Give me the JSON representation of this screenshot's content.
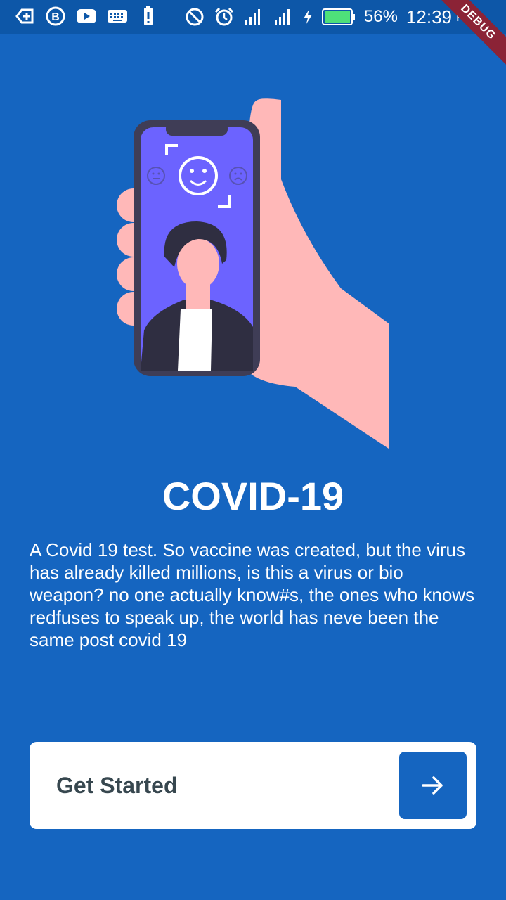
{
  "status_bar": {
    "battery_percent": "56%",
    "time": "12:39",
    "ampm": "PM",
    "left_icons": [
      "add-box-icon",
      "business-b-icon",
      "youtube-icon",
      "keyboard-icon",
      "battery-alert-icon"
    ],
    "right_icons": [
      "do-not-disturb-icon",
      "alarm-icon",
      "signal-icon",
      "signal-icon",
      "charging-icon",
      "battery-icon"
    ]
  },
  "debug_banner": "DEBUG",
  "illustration": {
    "icon": "face-scan-phone-illustration",
    "colors": {
      "skin": "#ffb8b8",
      "phone": "#3f3d56",
      "screen": "#6c63ff",
      "hair": "#2f2e41"
    }
  },
  "content": {
    "title": "COVID-19",
    "description": "A Covid 19 test. So vaccine was created, but the virus has already killed millions, is this a virus or bio weapon? no one actually know#s, the ones who knows redfuses to speak up, the world has neve been the same post covid 19"
  },
  "cta": {
    "label": "Get Started",
    "icon": "arrow-right-icon"
  },
  "colors": {
    "background": "#1565c0",
    "status_bar": "#0d57a8",
    "button_bg": "#ffffff",
    "button_text": "#37474f"
  }
}
